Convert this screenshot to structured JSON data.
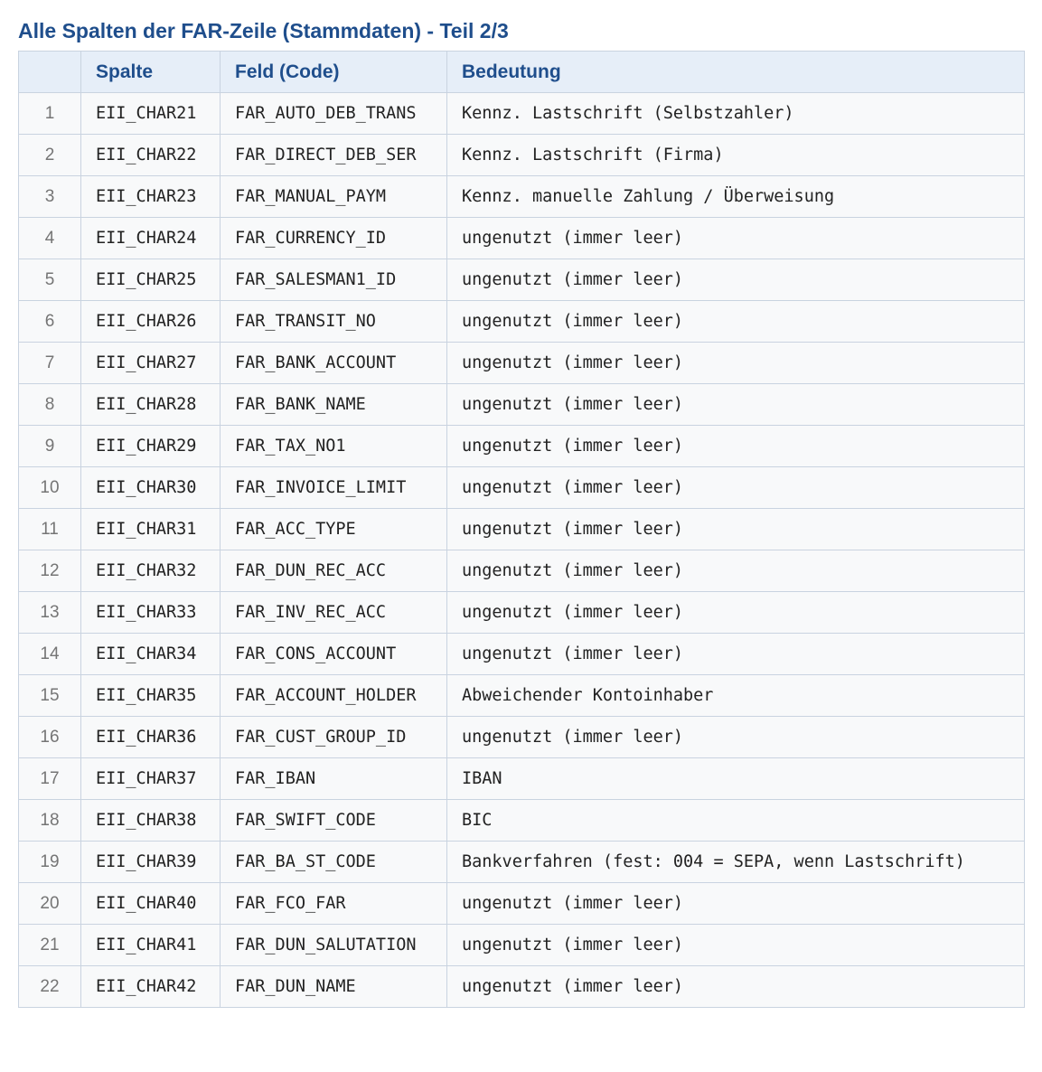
{
  "title": "Alle Spalten der FAR-Zeile (Stammdaten) - Teil 2/3",
  "table": {
    "headers": {
      "index": "",
      "spalte": "Spalte",
      "feld": "Feld (Code)",
      "bedeutung": "Bedeutung"
    },
    "rows": [
      {
        "index": "1",
        "spalte": "EII_CHAR21",
        "feld": "FAR_AUTO_DEB_TRANS",
        "bedeutung": "Kennz. Lastschrift (Selbstzahler)"
      },
      {
        "index": "2",
        "spalte": "EII_CHAR22",
        "feld": "FAR_DIRECT_DEB_SER",
        "bedeutung": "Kennz. Lastschrift (Firma)"
      },
      {
        "index": "3",
        "spalte": "EII_CHAR23",
        "feld": "FAR_MANUAL_PAYM",
        "bedeutung": "Kennz. manuelle Zahlung / Überweisung"
      },
      {
        "index": "4",
        "spalte": "EII_CHAR24",
        "feld": "FAR_CURRENCY_ID",
        "bedeutung": "ungenutzt (immer leer)"
      },
      {
        "index": "5",
        "spalte": "EII_CHAR25",
        "feld": "FAR_SALESMAN1_ID",
        "bedeutung": "ungenutzt (immer leer)"
      },
      {
        "index": "6",
        "spalte": "EII_CHAR26",
        "feld": "FAR_TRANSIT_NO",
        "bedeutung": "ungenutzt (immer leer)"
      },
      {
        "index": "7",
        "spalte": "EII_CHAR27",
        "feld": "FAR_BANK_ACCOUNT",
        "bedeutung": "ungenutzt (immer leer)"
      },
      {
        "index": "8",
        "spalte": "EII_CHAR28",
        "feld": "FAR_BANK_NAME",
        "bedeutung": "ungenutzt (immer leer)"
      },
      {
        "index": "9",
        "spalte": "EII_CHAR29",
        "feld": "FAR_TAX_NO1",
        "bedeutung": "ungenutzt (immer leer)"
      },
      {
        "index": "10",
        "spalte": "EII_CHAR30",
        "feld": "FAR_INVOICE_LIMIT",
        "bedeutung": "ungenutzt (immer leer)"
      },
      {
        "index": "11",
        "spalte": "EII_CHAR31",
        "feld": "FAR_ACC_TYPE",
        "bedeutung": "ungenutzt (immer leer)"
      },
      {
        "index": "12",
        "spalte": "EII_CHAR32",
        "feld": "FAR_DUN_REC_ACC",
        "bedeutung": "ungenutzt (immer leer)"
      },
      {
        "index": "13",
        "spalte": "EII_CHAR33",
        "feld": "FAR_INV_REC_ACC",
        "bedeutung": "ungenutzt (immer leer)"
      },
      {
        "index": "14",
        "spalte": "EII_CHAR34",
        "feld": "FAR_CONS_ACCOUNT",
        "bedeutung": "ungenutzt (immer leer)"
      },
      {
        "index": "15",
        "spalte": "EII_CHAR35",
        "feld": "FAR_ACCOUNT_HOLDER",
        "bedeutung": "Abweichender Kontoinhaber"
      },
      {
        "index": "16",
        "spalte": "EII_CHAR36",
        "feld": "FAR_CUST_GROUP_ID",
        "bedeutung": "ungenutzt (immer leer)"
      },
      {
        "index": "17",
        "spalte": "EII_CHAR37",
        "feld": "FAR_IBAN",
        "bedeutung": "IBAN"
      },
      {
        "index": "18",
        "spalte": "EII_CHAR38",
        "feld": "FAR_SWIFT_CODE",
        "bedeutung": "BIC"
      },
      {
        "index": "19",
        "spalte": "EII_CHAR39",
        "feld": "FAR_BA_ST_CODE",
        "bedeutung": "Bankverfahren (fest: 004 = SEPA, wenn Lastschrift)"
      },
      {
        "index": "20",
        "spalte": "EII_CHAR40",
        "feld": "FAR_FCO_FAR",
        "bedeutung": "ungenutzt (immer leer)"
      },
      {
        "index": "21",
        "spalte": "EII_CHAR41",
        "feld": "FAR_DUN_SALUTATION",
        "bedeutung": "ungenutzt (immer leer)"
      },
      {
        "index": "22",
        "spalte": "EII_CHAR42",
        "feld": "FAR_DUN_NAME",
        "bedeutung": "ungenutzt (immer leer)"
      }
    ]
  },
  "colors": {
    "title": "#1f4e8c",
    "header_bg": "#e6eef8",
    "cell_bg": "#f8f9fa",
    "border": "#c9d3e0",
    "index_text": "#757575"
  }
}
